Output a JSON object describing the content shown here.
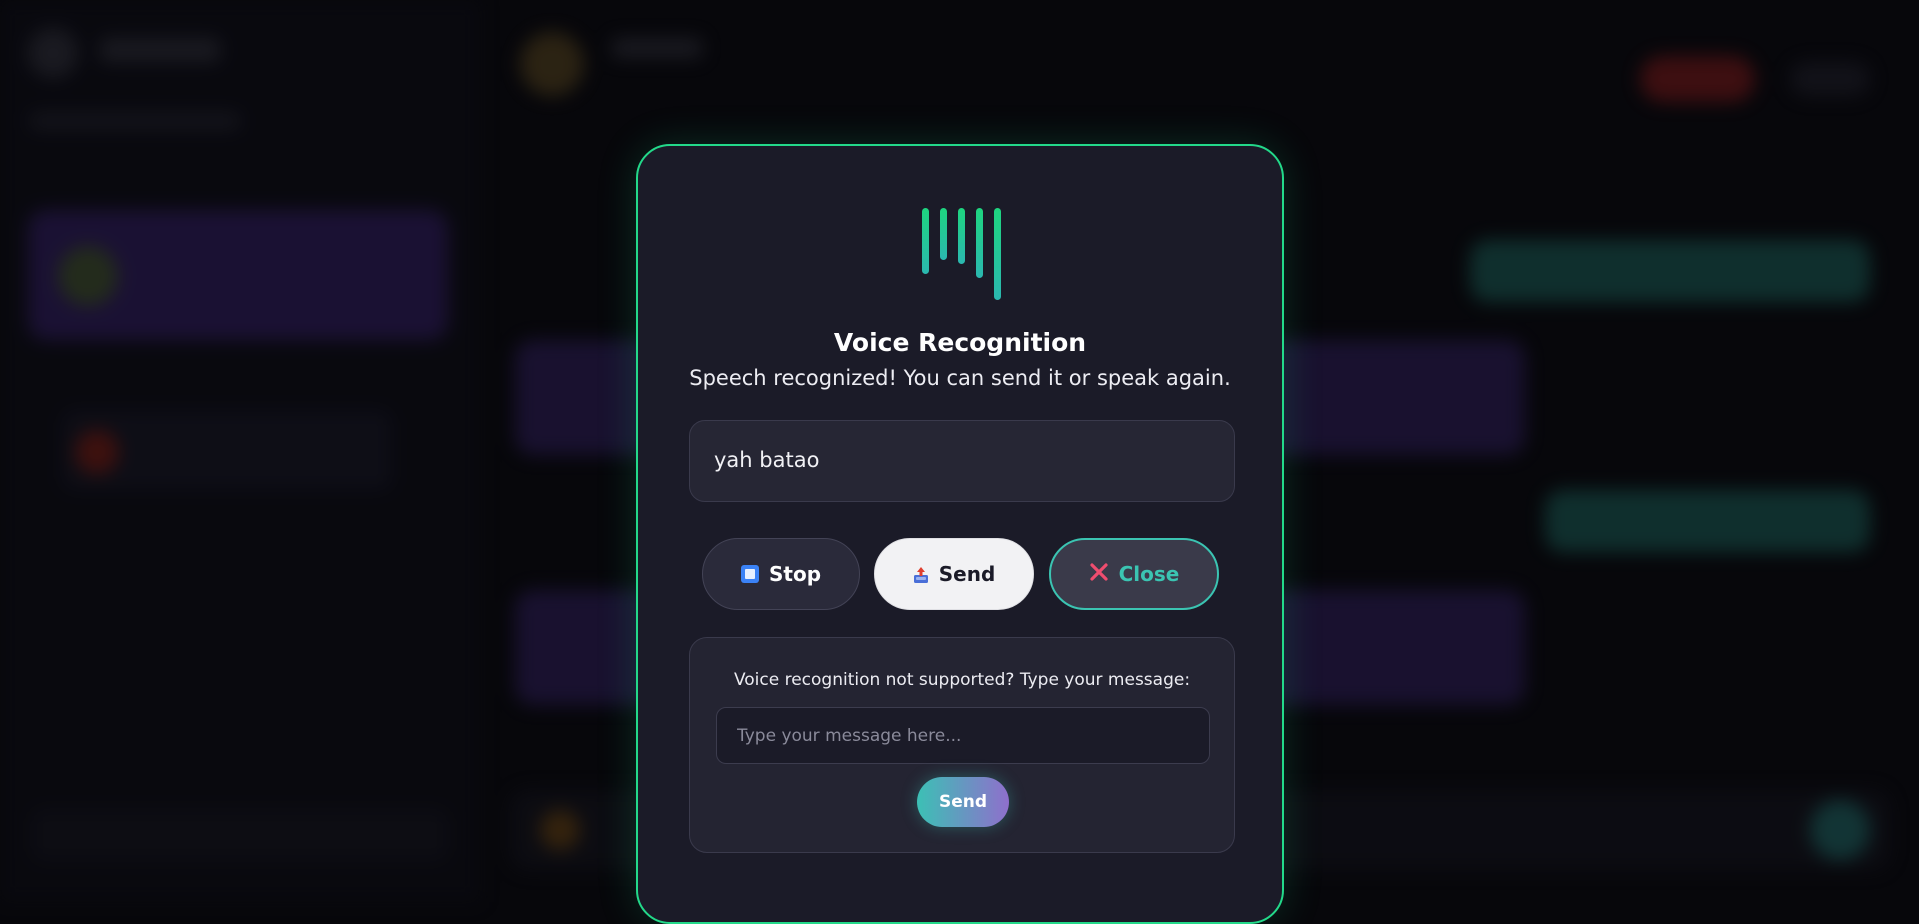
{
  "modal": {
    "title": "Voice Recognition",
    "status": "Speech recognized! You can send it or speak again.",
    "transcript": "yah batao",
    "buttons": {
      "stop": "Stop",
      "send": "Send",
      "close": "Close"
    },
    "fallback": {
      "label": "Voice recognition not supported? Type your message:",
      "placeholder": "Type your message here...",
      "send": "Send"
    }
  },
  "colors": {
    "accent_green": "#23d98a",
    "accent_teal": "#3bc4b2",
    "close_icon_red": "#ef4d6f",
    "stop_icon_blue": "#3b82f6",
    "modal_bg": "#1b1b28"
  },
  "icons": {
    "waveform": "sound-wave-icon",
    "stop": "stop-square-icon",
    "send": "outbox-tray-icon",
    "close": "x-mark-icon"
  }
}
